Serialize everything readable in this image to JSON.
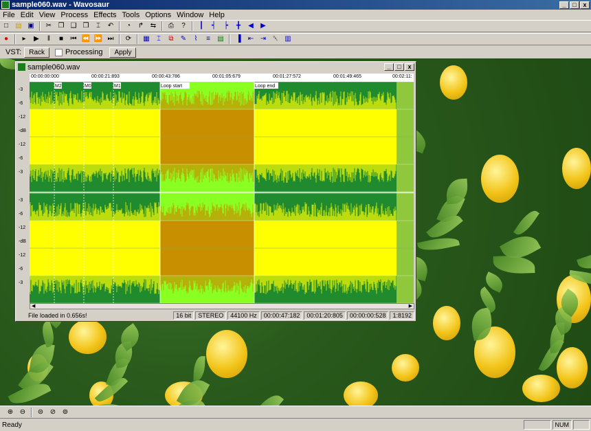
{
  "app": {
    "title": "sample060.wav - Wavosaur",
    "min": "_",
    "max": "□",
    "close": "x"
  },
  "menu": [
    "File",
    "Edit",
    "View",
    "Process",
    "Effects",
    "Tools",
    "Options",
    "Window",
    "Help"
  ],
  "toolbar1": [
    {
      "name": "new-icon",
      "glyph": "□",
      "color": "#000000"
    },
    {
      "name": "open-icon",
      "glyph": "▤",
      "color": "#c8a000"
    },
    {
      "name": "save-icon",
      "glyph": "▣",
      "color": "#00008a"
    },
    {
      "sep": true
    },
    {
      "name": "cut-icon",
      "glyph": "✂",
      "color": "#000000"
    },
    {
      "name": "copy-icon",
      "glyph": "❐",
      "color": "#000000"
    },
    {
      "name": "paste-icon",
      "glyph": "❑",
      "color": "#000000"
    },
    {
      "name": "paste-new-icon",
      "glyph": "❒",
      "color": "#000000"
    },
    {
      "name": "trim-icon",
      "glyph": "⌶",
      "color": "#000000"
    },
    {
      "name": "undo-icon",
      "glyph": "↶",
      "color": "#000000"
    },
    {
      "sep": true
    },
    {
      "name": "normalize-icon",
      "glyph": "◔",
      "color": "#000000"
    },
    {
      "name": "redo-icon",
      "glyph": "↱",
      "color": "#000000"
    },
    {
      "name": "loop-tool-icon",
      "glyph": "⇆",
      "color": "#000000"
    },
    {
      "sep": true
    },
    {
      "name": "print-icon",
      "glyph": "⎙",
      "color": "#000000"
    },
    {
      "name": "help-icon",
      "glyph": "?",
      "color": "#000000"
    },
    {
      "sep": true
    },
    {
      "name": "marker-add-icon",
      "glyph": "┃",
      "color": "#0000cc"
    },
    {
      "name": "marker-prev-icon",
      "glyph": "┥",
      "color": "#0000cc"
    },
    {
      "name": "marker-next-icon",
      "glyph": "┝",
      "color": "#0000cc"
    },
    {
      "name": "marker-del-icon",
      "glyph": "╋",
      "color": "#0000cc"
    },
    {
      "name": "nav-left-icon",
      "glyph": "◀",
      "color": "#0000cc"
    },
    {
      "name": "nav-right-icon",
      "glyph": "▶",
      "color": "#0000cc"
    }
  ],
  "toolbar2": [
    {
      "name": "record-icon",
      "glyph": "●",
      "color": "#dd0000"
    },
    {
      "sep": true
    },
    {
      "name": "play-from-icon",
      "glyph": "▸",
      "color": "#000000"
    },
    {
      "name": "play-icon",
      "glyph": "▶",
      "color": "#000000"
    },
    {
      "name": "pause-icon",
      "glyph": "‖",
      "color": "#000000"
    },
    {
      "name": "stop-icon",
      "glyph": "■",
      "color": "#000000"
    },
    {
      "name": "skip-start-icon",
      "glyph": "⏮",
      "color": "#000000"
    },
    {
      "name": "rewind-icon",
      "glyph": "⏪",
      "color": "#000000"
    },
    {
      "name": "fast-forward-icon",
      "glyph": "⏩",
      "color": "#000000"
    },
    {
      "name": "skip-end-icon",
      "glyph": "⏭",
      "color": "#000000"
    },
    {
      "sep": true
    },
    {
      "name": "loop-play-icon",
      "glyph": "⟳",
      "color": "#000000"
    },
    {
      "sep": true
    },
    {
      "name": "select-all-icon",
      "glyph": "▦",
      "color": "#0000cc"
    },
    {
      "name": "zoom-wave-icon",
      "glyph": "⌶",
      "color": "#0000cc"
    },
    {
      "name": "loop-select-icon",
      "glyph": "⧉",
      "color": "#cc0000"
    },
    {
      "name": "edit-wave-icon",
      "glyph": "✎",
      "color": "#0000cc"
    },
    {
      "name": "draw-wave-icon",
      "glyph": "⌇",
      "color": "#0000cc"
    },
    {
      "name": "align-icon",
      "glyph": "≡",
      "color": "#0000cc"
    },
    {
      "name": "grid-icon",
      "glyph": "▤",
      "color": "#008000"
    },
    {
      "sep": true
    },
    {
      "name": "marker-start-icon",
      "glyph": "▐",
      "color": "#0000cc"
    },
    {
      "name": "marker-left-icon",
      "glyph": "⇤",
      "color": "#0000cc"
    },
    {
      "name": "marker-right-icon",
      "glyph": "⇥",
      "color": "#0000cc"
    },
    {
      "name": "trash-icon",
      "glyph": "␡",
      "color": "#000000"
    },
    {
      "name": "region-icon",
      "glyph": "▥",
      "color": "#0000cc"
    }
  ],
  "vst": {
    "label": "VST:",
    "rack": "Rack",
    "processing": "Processing",
    "apply": "Apply"
  },
  "doc": {
    "title": "sample060.wav",
    "ruler": [
      "00:00:00:000",
      "00:00:21:893",
      "00:00:43:786",
      "00:01:05:679",
      "00:01:27:572",
      "00:01:49:465",
      "00:02:11:"
    ],
    "markers": [
      "M2",
      "M0",
      "M1",
      "Loop start",
      "Loop end"
    ],
    "db_labels": [
      "-3",
      "-6",
      "-12",
      "-dB",
      "-12",
      "-6",
      "-3"
    ],
    "status": {
      "message": "File loaded in 0.656s!",
      "bits": "16 bit",
      "channels": "STEREO",
      "rate": "44100 Hz",
      "pos": "00:00:47:182",
      "sel": "00:01:20:805",
      "len": "00:00:00:528",
      "zoom": "1:8192"
    }
  },
  "colors": {
    "wave_bg": "#1f8a2e",
    "wave": "#ffff00",
    "loop_bg": "#8aff22",
    "loop_wave": "#c89000",
    "tail": "#8fc83c"
  },
  "bottom_toolbar": [
    {
      "name": "zoom-in-icon",
      "glyph": "⊕"
    },
    {
      "name": "zoom-out-icon",
      "glyph": "⊖"
    },
    {
      "sep": true
    },
    {
      "name": "zoom-fit-icon",
      "glyph": "⊜"
    },
    {
      "name": "zoom-selection-icon",
      "glyph": "⊘"
    },
    {
      "name": "zoom-full-icon",
      "glyph": "⊚"
    }
  ],
  "statusbar": {
    "ready": "Ready",
    "num": "NUM"
  }
}
